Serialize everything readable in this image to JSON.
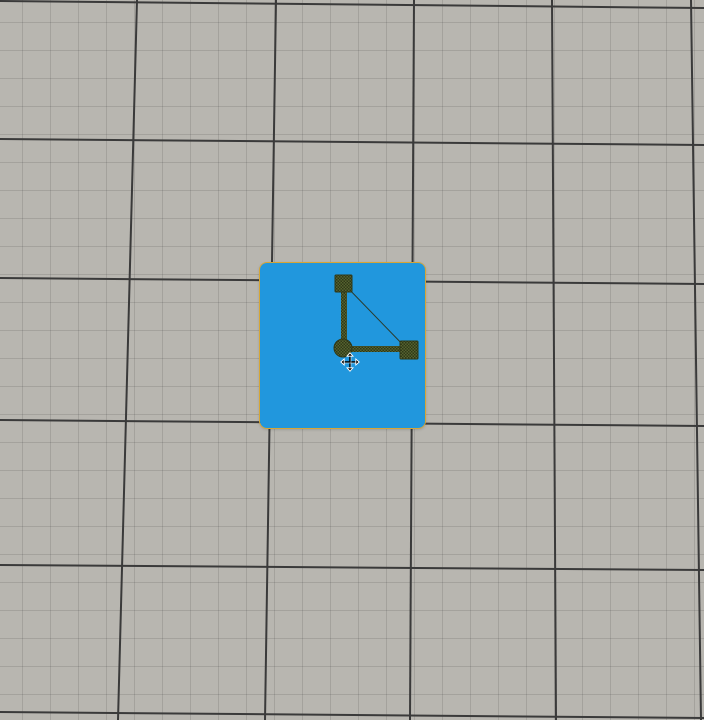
{
  "canvas": {
    "background_color": "#b8b6b0",
    "grid_line_color": "#3a3a3a"
  },
  "shape": {
    "fill_color": "#2197dd",
    "selection_outline_color": "#d6a636"
  },
  "handles": {
    "fill_color": "#4e5b2c",
    "line_color": "#3c4a20"
  },
  "cursor": {
    "icon": "move-cursor-icon"
  }
}
